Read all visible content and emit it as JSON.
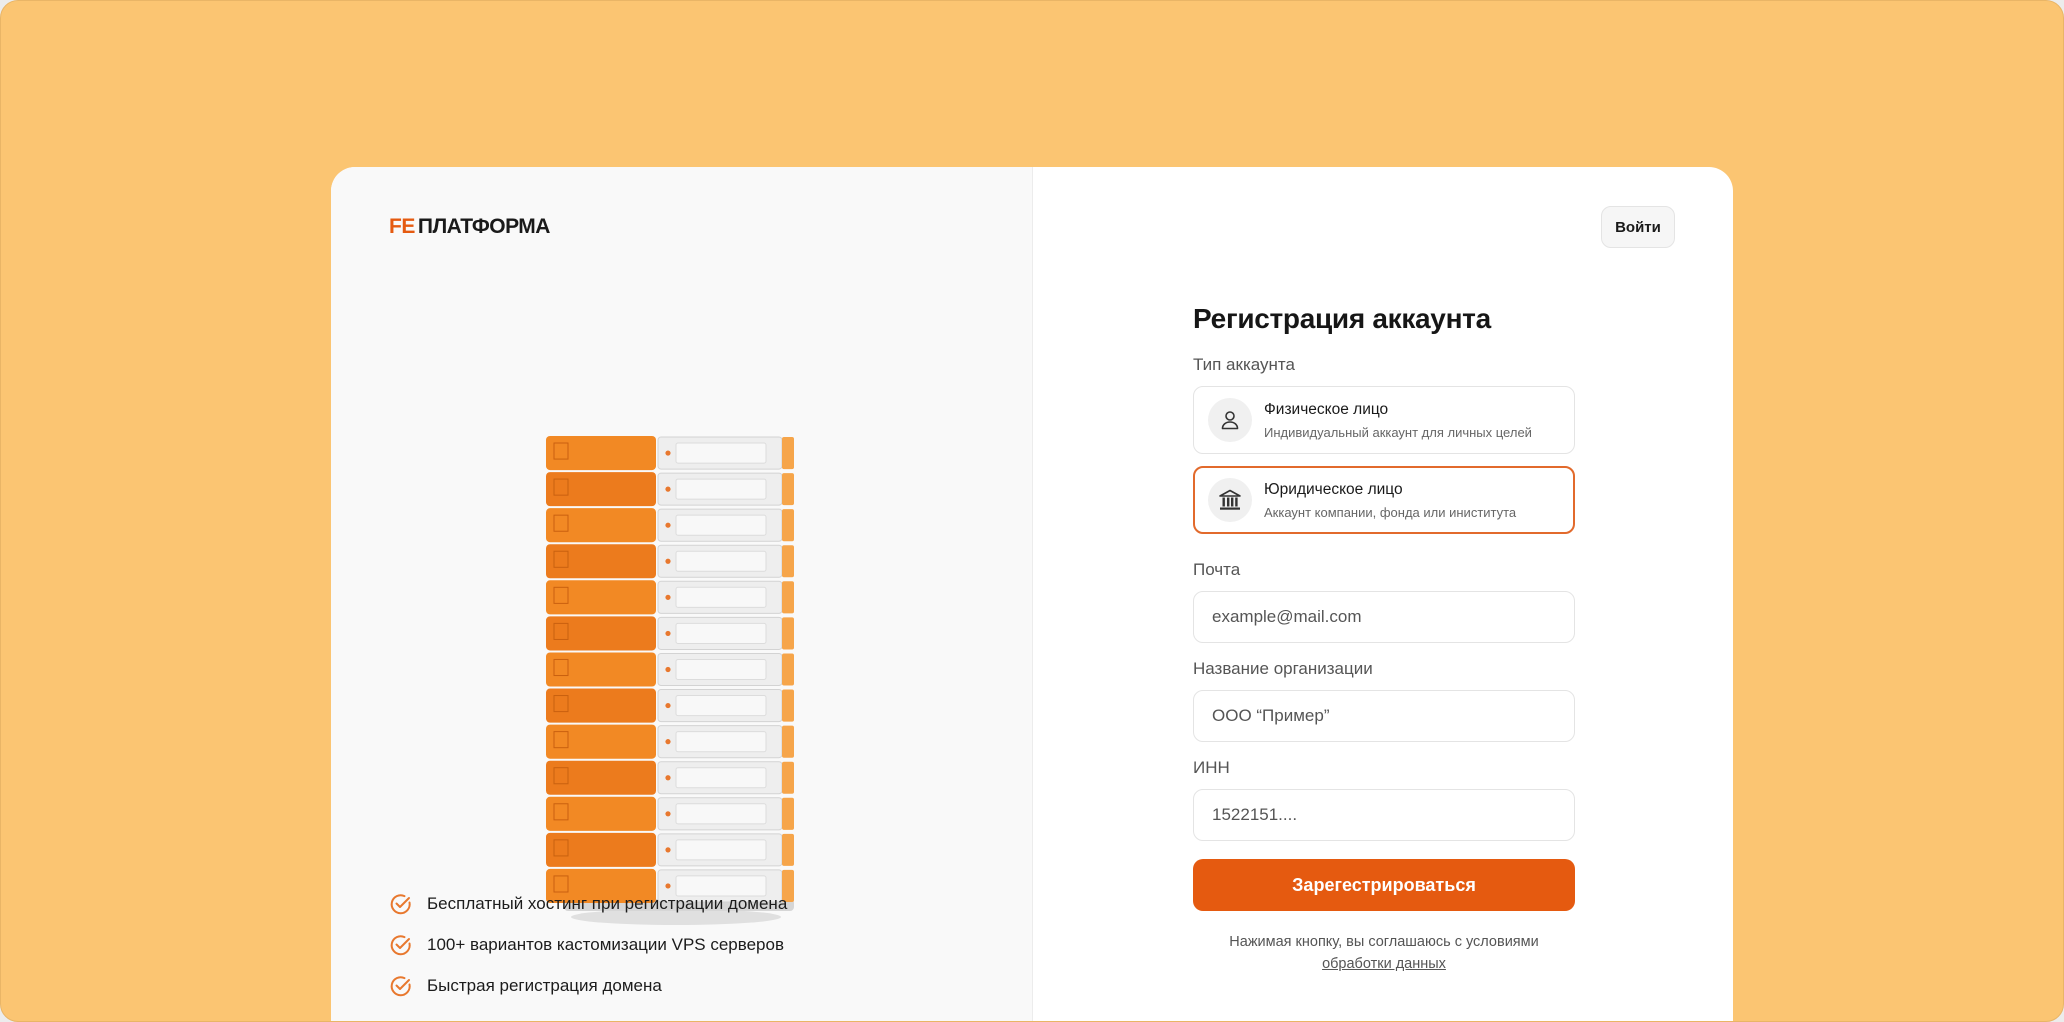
{
  "brand": {
    "mark": "FE",
    "name": "ПЛАТФОРМА",
    "accent": "#e55a10",
    "background": "#fbc572"
  },
  "header": {
    "login_label": "Войти"
  },
  "illustration": {
    "icon": "server-rack-illustration",
    "unit_count": 13
  },
  "features": [
    {
      "icon": "check-circle-icon",
      "label": "Бесплатный хостинг при регистрации домена"
    },
    {
      "icon": "check-circle-icon",
      "label": "100+ вариантов кастомизации VPS серверов"
    },
    {
      "icon": "check-circle-icon",
      "label": "Быстрая регистрация домена"
    }
  ],
  "form": {
    "title": "Регистрация аккаунта",
    "account_type_label": "Тип аккаунта",
    "account_types": [
      {
        "icon": "user-icon",
        "title": "Физическое лицо",
        "description": "Индивидуальный аккаунт для личных целей",
        "selected": false
      },
      {
        "icon": "bank-icon",
        "title": "Юридическое лицо",
        "description": "Аккаунт компании, фонда или иниститута",
        "selected": true
      }
    ],
    "email": {
      "label": "Почта",
      "placeholder": "example@mail.com"
    },
    "organization": {
      "label": "Название организации",
      "placeholder": "ООО “Пример”"
    },
    "inn": {
      "label": "ИНН",
      "placeholder": "1522151...."
    },
    "submit_label": "Зарегестрироваться",
    "consent_text": "Нажимая кнопку, вы соглашаюсь с условиями",
    "consent_link": "обработки данных"
  }
}
